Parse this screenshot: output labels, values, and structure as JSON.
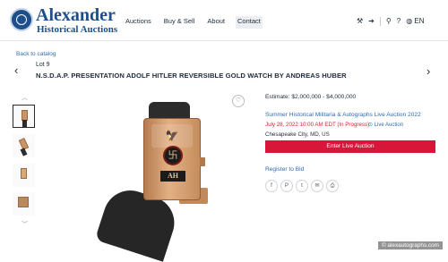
{
  "brand": {
    "line1": "Alexander",
    "line2": "Historical Auctions"
  },
  "nav": [
    "Auctions",
    "Buy & Sell",
    "About",
    "Contact"
  ],
  "header_icons": {
    "gavel": "gavel-icon",
    "login": "sign-in-icon",
    "search": "search-icon",
    "help": "help-icon",
    "language": "EN"
  },
  "breadcrumb": {
    "back": "Back to catalog"
  },
  "lot": {
    "label": "Lot 9",
    "title": "N.S.D.A.P. PRESENTATION ADOLF HITLER REVERSIBLE GOLD WATCH BY ANDREAS HUBER"
  },
  "watch": {
    "initials": "AH",
    "swastika": "卐"
  },
  "estimate": "Estimate: $2,000,000 - $4,000,000",
  "sale": {
    "name": "Summer Historical Militaria & Autographs Live Auction 2022",
    "date": "July 28, 2022 10:00 AM EDT (In Progress)",
    "live": "Live Auction",
    "location": "Chesapeake City, MD, US"
  },
  "buttons": {
    "enter_live": "Enter Live Auction",
    "register": "Register to Bid"
  },
  "share_icons": [
    "facebook-icon",
    "pinterest-icon",
    "twitter-icon",
    "email-icon",
    "print-icon"
  ],
  "credit": "© alexautographs.com",
  "colors": {
    "brand": "#1d4f8c",
    "link": "#2e6db4",
    "accent": "#d8163a"
  }
}
